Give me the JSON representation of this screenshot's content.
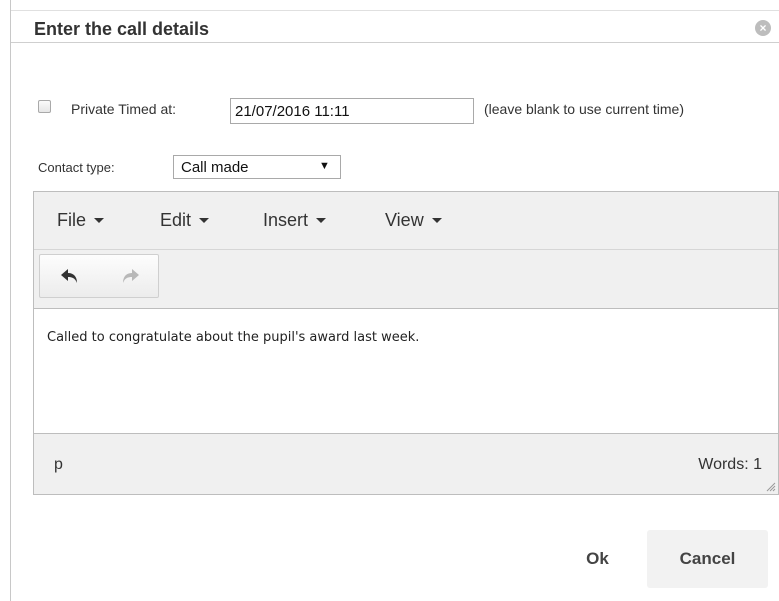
{
  "dialog": {
    "title": "Enter the call details",
    "close_icon": "×"
  },
  "form": {
    "private_label": "Private Timed at:",
    "timed_value": "21/07/2016 11:11",
    "timed_hint": "(leave blank to use current time)",
    "contact_type_label": "Contact type:",
    "contact_type_value": "Call made"
  },
  "editor": {
    "menus": [
      {
        "label": "File"
      },
      {
        "label": "Edit"
      },
      {
        "label": "Insert"
      },
      {
        "label": "View"
      }
    ],
    "toolbar": {
      "undo_icon": "undo-icon",
      "redo_icon": "redo-icon"
    },
    "content": "Called to congratulate about the pupil's award last week.",
    "status_path": "p",
    "word_count": "Words: 1"
  },
  "buttons": {
    "ok_label": "Ok",
    "cancel_label": "Cancel"
  }
}
